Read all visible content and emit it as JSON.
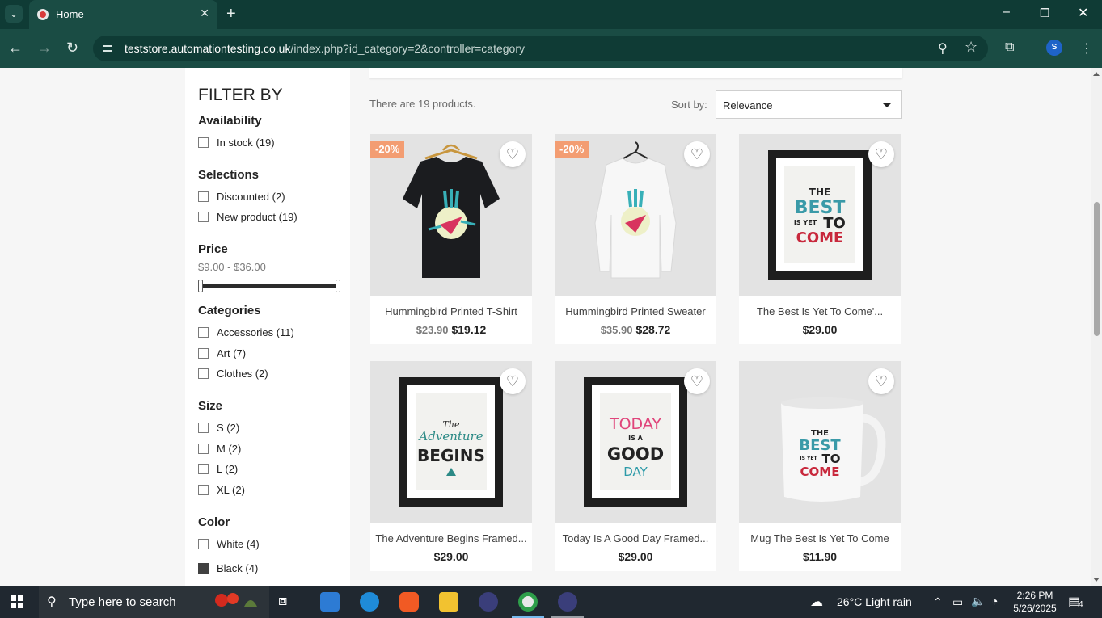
{
  "browser": {
    "tab_title": "Home",
    "new_tab": "+",
    "tab_close": "✕",
    "url_host": "teststore.automationtesting.co.uk",
    "url_path": "/index.php?id_category=2&controller=category",
    "profile_initial": "S",
    "icons": {
      "back": "←",
      "forward": "→",
      "reload": "↻",
      "zoom": "⚲",
      "star": "☆",
      "extensions": "⧉",
      "menu": "⋮",
      "minimize": "–",
      "restore": "❐",
      "close": "✕",
      "tab_search": "⌄"
    }
  },
  "filters": {
    "title": "FILTER BY",
    "availability": {
      "title": "Availability",
      "options": [
        "In stock (19)"
      ]
    },
    "selections": {
      "title": "Selections",
      "options": [
        "Discounted (2)",
        "New product (19)"
      ]
    },
    "price": {
      "title": "Price",
      "range": "$9.00 - $36.00",
      "min": 9,
      "max": 36
    },
    "categories": {
      "title": "Categories",
      "options": [
        "Accessories (11)",
        "Art (7)",
        "Clothes (2)"
      ]
    },
    "size": {
      "title": "Size",
      "options": [
        "S (2)",
        "M (2)",
        "L (2)",
        "XL (2)"
      ]
    },
    "color": {
      "title": "Color",
      "options": [
        "White (4)",
        "Black (4)"
      ],
      "swatches": [
        "#ffffff",
        "#434a54"
      ]
    }
  },
  "listing": {
    "count_text": "There are 19 products.",
    "sort_label": "Sort by:",
    "sort_value": "Relevance"
  },
  "products": [
    {
      "name": "Hummingbird Printed T-Shirt",
      "old_price": "$23.90",
      "price": "$19.12",
      "badge": "-20%"
    },
    {
      "name": "Hummingbird Printed Sweater",
      "old_price": "$35.90",
      "price": "$28.72",
      "badge": "-20%"
    },
    {
      "name": "The Best Is Yet To Come'...",
      "old_price": "",
      "price": "$29.00",
      "badge": ""
    },
    {
      "name": "The Adventure Begins Framed...",
      "old_price": "",
      "price": "$29.00",
      "badge": ""
    },
    {
      "name": "Today Is A Good Day Framed...",
      "old_price": "",
      "price": "$29.00",
      "badge": ""
    },
    {
      "name": "Mug The Best Is Yet To Come",
      "old_price": "",
      "price": "$11.90",
      "badge": ""
    }
  ],
  "artwork": {
    "best_lines": [
      "THE",
      "BEST",
      "IS YET",
      "TO",
      "COME"
    ],
    "adventure_lines": [
      "The",
      "Adventure",
      "BEGINS"
    ],
    "today_lines": [
      "TODAY",
      "IS A",
      "GOOD",
      "DAY"
    ]
  },
  "taskbar": {
    "search_placeholder": "Type here to search",
    "weather": "26°C  Light rain",
    "time": "2:26 PM",
    "date": "5/26/2025",
    "notifications": "4"
  },
  "colors": {
    "accent_badge": "#f39d72",
    "chrome_dark": "#0f3b35",
    "chrome": "#1a4c44"
  }
}
